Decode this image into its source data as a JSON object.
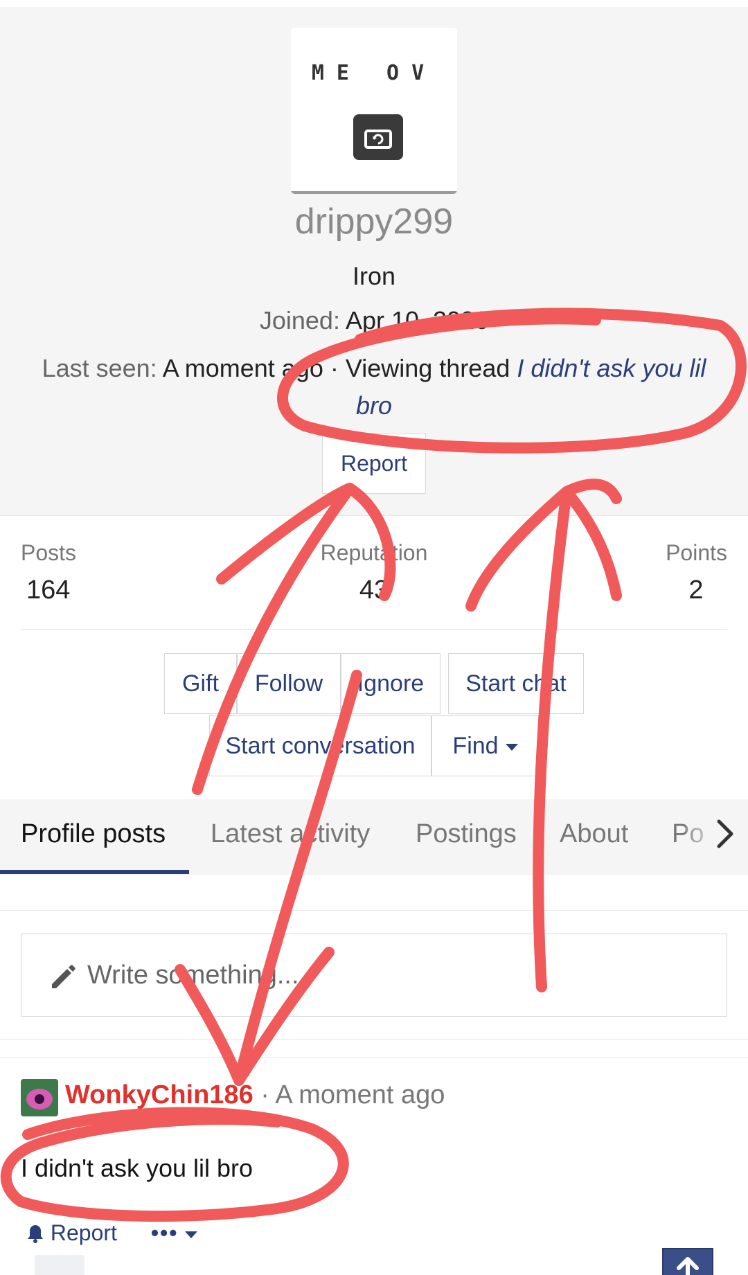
{
  "profile": {
    "avatar_text": "ME OV",
    "username": "drippy299",
    "rank": "Iron",
    "joined_label": "Joined:",
    "joined_value": "Apr 10, 2026",
    "last_seen_label": "Last seen:",
    "last_seen_value": "A moment ago",
    "activity_prefix": "· Viewing thread",
    "thread_title": "I didn't ask you lil bro",
    "report_label": "Report"
  },
  "stats": {
    "posts_label": "Posts",
    "posts_value": "164",
    "reputation_label": "Reputation",
    "reputation_value": "43",
    "points_label": "Points",
    "points_value": "2"
  },
  "actions": {
    "gift": "Gift",
    "follow": "Follow",
    "ignore": "Ignore",
    "start_chat": "Start chat",
    "start_conversation": "Start conversation",
    "find": "Find"
  },
  "tabs": [
    {
      "label": "Profile posts"
    },
    {
      "label": "Latest activity"
    },
    {
      "label": "Postings"
    },
    {
      "label": "About"
    },
    {
      "label": "Po"
    }
  ],
  "composer": {
    "placeholder": "Write something..."
  },
  "post": {
    "author": "WonkyChin186",
    "time": "· A moment ago",
    "body": "I didn't ask you lil bro",
    "report_label": "Report",
    "more_label": "•••"
  },
  "annotation_color": "#f15a5a"
}
